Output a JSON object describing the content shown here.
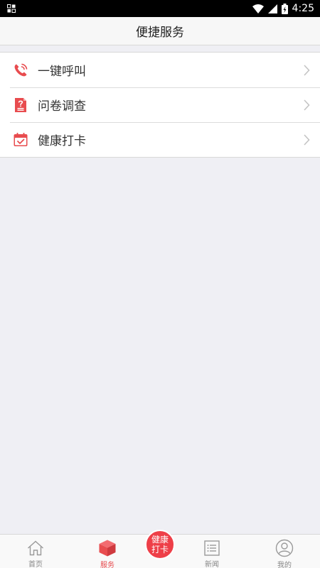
{
  "status_bar": {
    "time": "4:25"
  },
  "header": {
    "title": "便捷服务"
  },
  "menu": [
    {
      "label": "一键呼叫",
      "icon": "phone-call-icon"
    },
    {
      "label": "问卷调查",
      "icon": "questionnaire-icon"
    },
    {
      "label": "健康打卡",
      "icon": "calendar-check-icon"
    }
  ],
  "tabs": [
    {
      "label": "首页",
      "icon": "home-icon",
      "active": false
    },
    {
      "label": "服务",
      "icon": "box-icon",
      "active": true
    },
    {
      "label": "新闻",
      "icon": "news-list-icon",
      "active": false
    },
    {
      "label": "我的",
      "icon": "profile-icon",
      "active": false
    }
  ],
  "fab": {
    "line1": "健康",
    "line2": "打卡"
  },
  "colors": {
    "accent": "#ee3f48",
    "background": "#efeff4"
  }
}
